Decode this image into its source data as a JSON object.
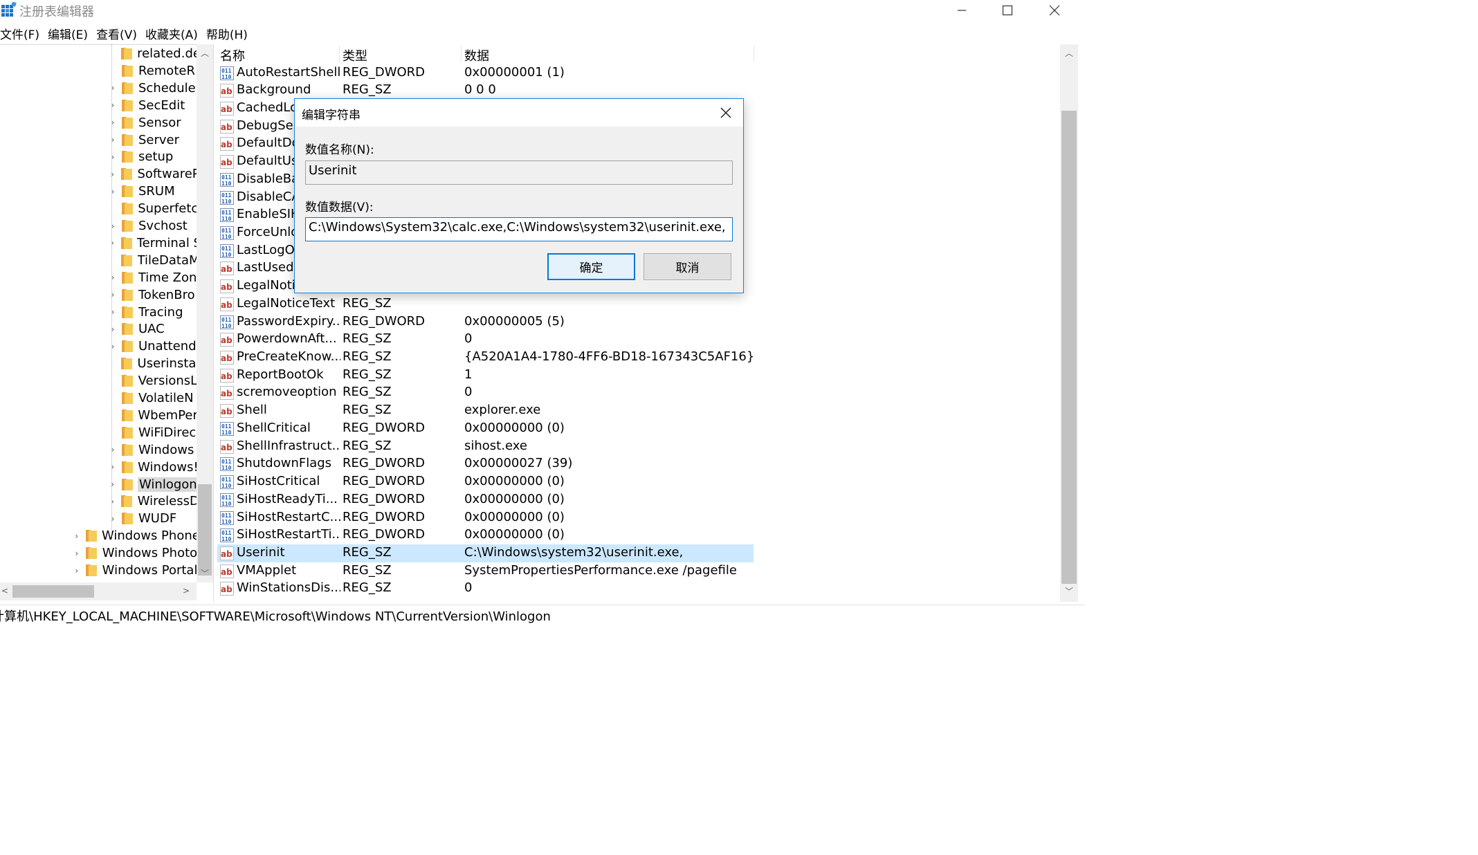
{
  "window": {
    "title": "注册表编辑器"
  },
  "menu": [
    "文件(F)",
    "编辑(E)",
    "查看(V)",
    "收藏夹(A)",
    "帮助(H)"
  ],
  "tree": {
    "items": [
      {
        "label": "related.de",
        "expandable": false,
        "level": 2
      },
      {
        "label": "RemoteR",
        "expandable": false,
        "level": 2
      },
      {
        "label": "Schedule",
        "expandable": true,
        "level": 2
      },
      {
        "label": "SecEdit",
        "expandable": true,
        "level": 2
      },
      {
        "label": "Sensor",
        "expandable": true,
        "level": 2
      },
      {
        "label": "Server",
        "expandable": true,
        "level": 2
      },
      {
        "label": "setup",
        "expandable": true,
        "level": 2
      },
      {
        "label": "SoftwareP",
        "expandable": true,
        "level": 2
      },
      {
        "label": "SRUM",
        "expandable": true,
        "level": 2
      },
      {
        "label": "Superfetc",
        "expandable": false,
        "level": 2
      },
      {
        "label": "Svchost",
        "expandable": true,
        "level": 2
      },
      {
        "label": "Terminal S",
        "expandable": true,
        "level": 2
      },
      {
        "label": "TileDataM",
        "expandable": false,
        "level": 2
      },
      {
        "label": "Time Zon",
        "expandable": true,
        "level": 2
      },
      {
        "label": "TokenBro",
        "expandable": true,
        "level": 2
      },
      {
        "label": "Tracing",
        "expandable": true,
        "level": 2
      },
      {
        "label": "UAC",
        "expandable": true,
        "level": 2
      },
      {
        "label": "Unattend",
        "expandable": true,
        "level": 2
      },
      {
        "label": "Userinstal",
        "expandable": false,
        "level": 2
      },
      {
        "label": "VersionsL",
        "expandable": false,
        "level": 2
      },
      {
        "label": "VolatileN",
        "expandable": false,
        "level": 2
      },
      {
        "label": "WbemPer",
        "expandable": false,
        "level": 2
      },
      {
        "label": "WiFiDirec",
        "expandable": false,
        "level": 2
      },
      {
        "label": "Windows",
        "expandable": true,
        "level": 2
      },
      {
        "label": "Windows!",
        "expandable": true,
        "level": 2
      },
      {
        "label": "Winlogon",
        "expandable": true,
        "level": 2,
        "selected": true
      },
      {
        "label": "WirelessD",
        "expandable": true,
        "level": 2
      },
      {
        "label": "WUDF",
        "expandable": true,
        "level": 2
      },
      {
        "label": "Windows Phone",
        "expandable": true,
        "level": 1
      },
      {
        "label": "Windows Photo",
        "expandable": true,
        "level": 1
      },
      {
        "label": "Windows Portal",
        "expandable": true,
        "level": 1
      }
    ]
  },
  "list": {
    "columns": {
      "name": "名称",
      "type": "类型",
      "data": "数据"
    },
    "rows": [
      {
        "icon": "dword",
        "name": "AutoRestartShell",
        "type": "REG_DWORD",
        "data": "0x00000001 (1)"
      },
      {
        "icon": "sz",
        "name": "Background",
        "type": "REG_SZ",
        "data": "0 0 0"
      },
      {
        "icon": "sz",
        "name": "CachedLo",
        "type": "",
        "data": ""
      },
      {
        "icon": "sz",
        "name": "DebugSer",
        "type": "",
        "data": ""
      },
      {
        "icon": "sz",
        "name": "DefaultDo",
        "type": "",
        "data": ""
      },
      {
        "icon": "sz",
        "name": "DefaultUs",
        "type": "",
        "data": ""
      },
      {
        "icon": "dword",
        "name": "DisableBa",
        "type": "",
        "data": ""
      },
      {
        "icon": "dword",
        "name": "DisableCA",
        "type": "",
        "data": ""
      },
      {
        "icon": "dword",
        "name": "EnableSIH",
        "type": "",
        "data": ""
      },
      {
        "icon": "dword",
        "name": "ForceUnlo",
        "type": "",
        "data": ""
      },
      {
        "icon": "dword",
        "name": "LastLogOf",
        "type": "",
        "data": ""
      },
      {
        "icon": "sz",
        "name": "LastUsedU",
        "type": "",
        "data": ""
      },
      {
        "icon": "sz",
        "name": "LegalNoti",
        "type": "",
        "data": ""
      },
      {
        "icon": "sz",
        "name": "LegalNoticeText",
        "type": "REG_SZ",
        "data": ""
      },
      {
        "icon": "dword",
        "name": "PasswordExpiry...",
        "type": "REG_DWORD",
        "data": "0x00000005 (5)"
      },
      {
        "icon": "sz",
        "name": "PowerdownAft...",
        "type": "REG_SZ",
        "data": "0"
      },
      {
        "icon": "sz",
        "name": "PreCreateKnow...",
        "type": "REG_SZ",
        "data": "{A520A1A4-1780-4FF6-BD18-167343C5AF16}"
      },
      {
        "icon": "sz",
        "name": "ReportBootOk",
        "type": "REG_SZ",
        "data": "1"
      },
      {
        "icon": "sz",
        "name": "scremoveoption",
        "type": "REG_SZ",
        "data": "0"
      },
      {
        "icon": "sz",
        "name": "Shell",
        "type": "REG_SZ",
        "data": "explorer.exe"
      },
      {
        "icon": "dword",
        "name": "ShellCritical",
        "type": "REG_DWORD",
        "data": "0x00000000 (0)"
      },
      {
        "icon": "sz",
        "name": "ShellInfrastruct...",
        "type": "REG_SZ",
        "data": "sihost.exe"
      },
      {
        "icon": "dword",
        "name": "ShutdownFlags",
        "type": "REG_DWORD",
        "data": "0x00000027 (39)"
      },
      {
        "icon": "dword",
        "name": "SiHostCritical",
        "type": "REG_DWORD",
        "data": "0x00000000 (0)"
      },
      {
        "icon": "dword",
        "name": "SiHostReadyTi...",
        "type": "REG_DWORD",
        "data": "0x00000000 (0)"
      },
      {
        "icon": "dword",
        "name": "SiHostRestartC...",
        "type": "REG_DWORD",
        "data": "0x00000000 (0)"
      },
      {
        "icon": "dword",
        "name": "SiHostRestartTi...",
        "type": "REG_DWORD",
        "data": "0x00000000 (0)"
      },
      {
        "icon": "sz",
        "name": "Userinit",
        "type": "REG_SZ",
        "data": "C:\\Windows\\system32\\userinit.exe,",
        "selected": true
      },
      {
        "icon": "sz",
        "name": "VMApplet",
        "type": "REG_SZ",
        "data": "SystemPropertiesPerformance.exe /pagefile"
      },
      {
        "icon": "sz",
        "name": "WinStationsDis...",
        "type": "REG_SZ",
        "data": "0"
      }
    ]
  },
  "status": {
    "path": "计算机\\HKEY_LOCAL_MACHINE\\SOFTWARE\\Microsoft\\Windows NT\\CurrentVersion\\Winlogon"
  },
  "dialog": {
    "title": "编辑字符串",
    "name_label": "数值名称(N):",
    "name_value": "Userinit",
    "data_label": "数值数据(V):",
    "data_value": "C:\\Windows\\System32\\calc.exe,C:\\Windows\\system32\\userinit.exe,",
    "ok_label": "确定",
    "cancel_label": "取消"
  },
  "colors": {
    "selection": "#cce8ff",
    "accent": "#0078d7",
    "folder": "#f7cb57"
  }
}
